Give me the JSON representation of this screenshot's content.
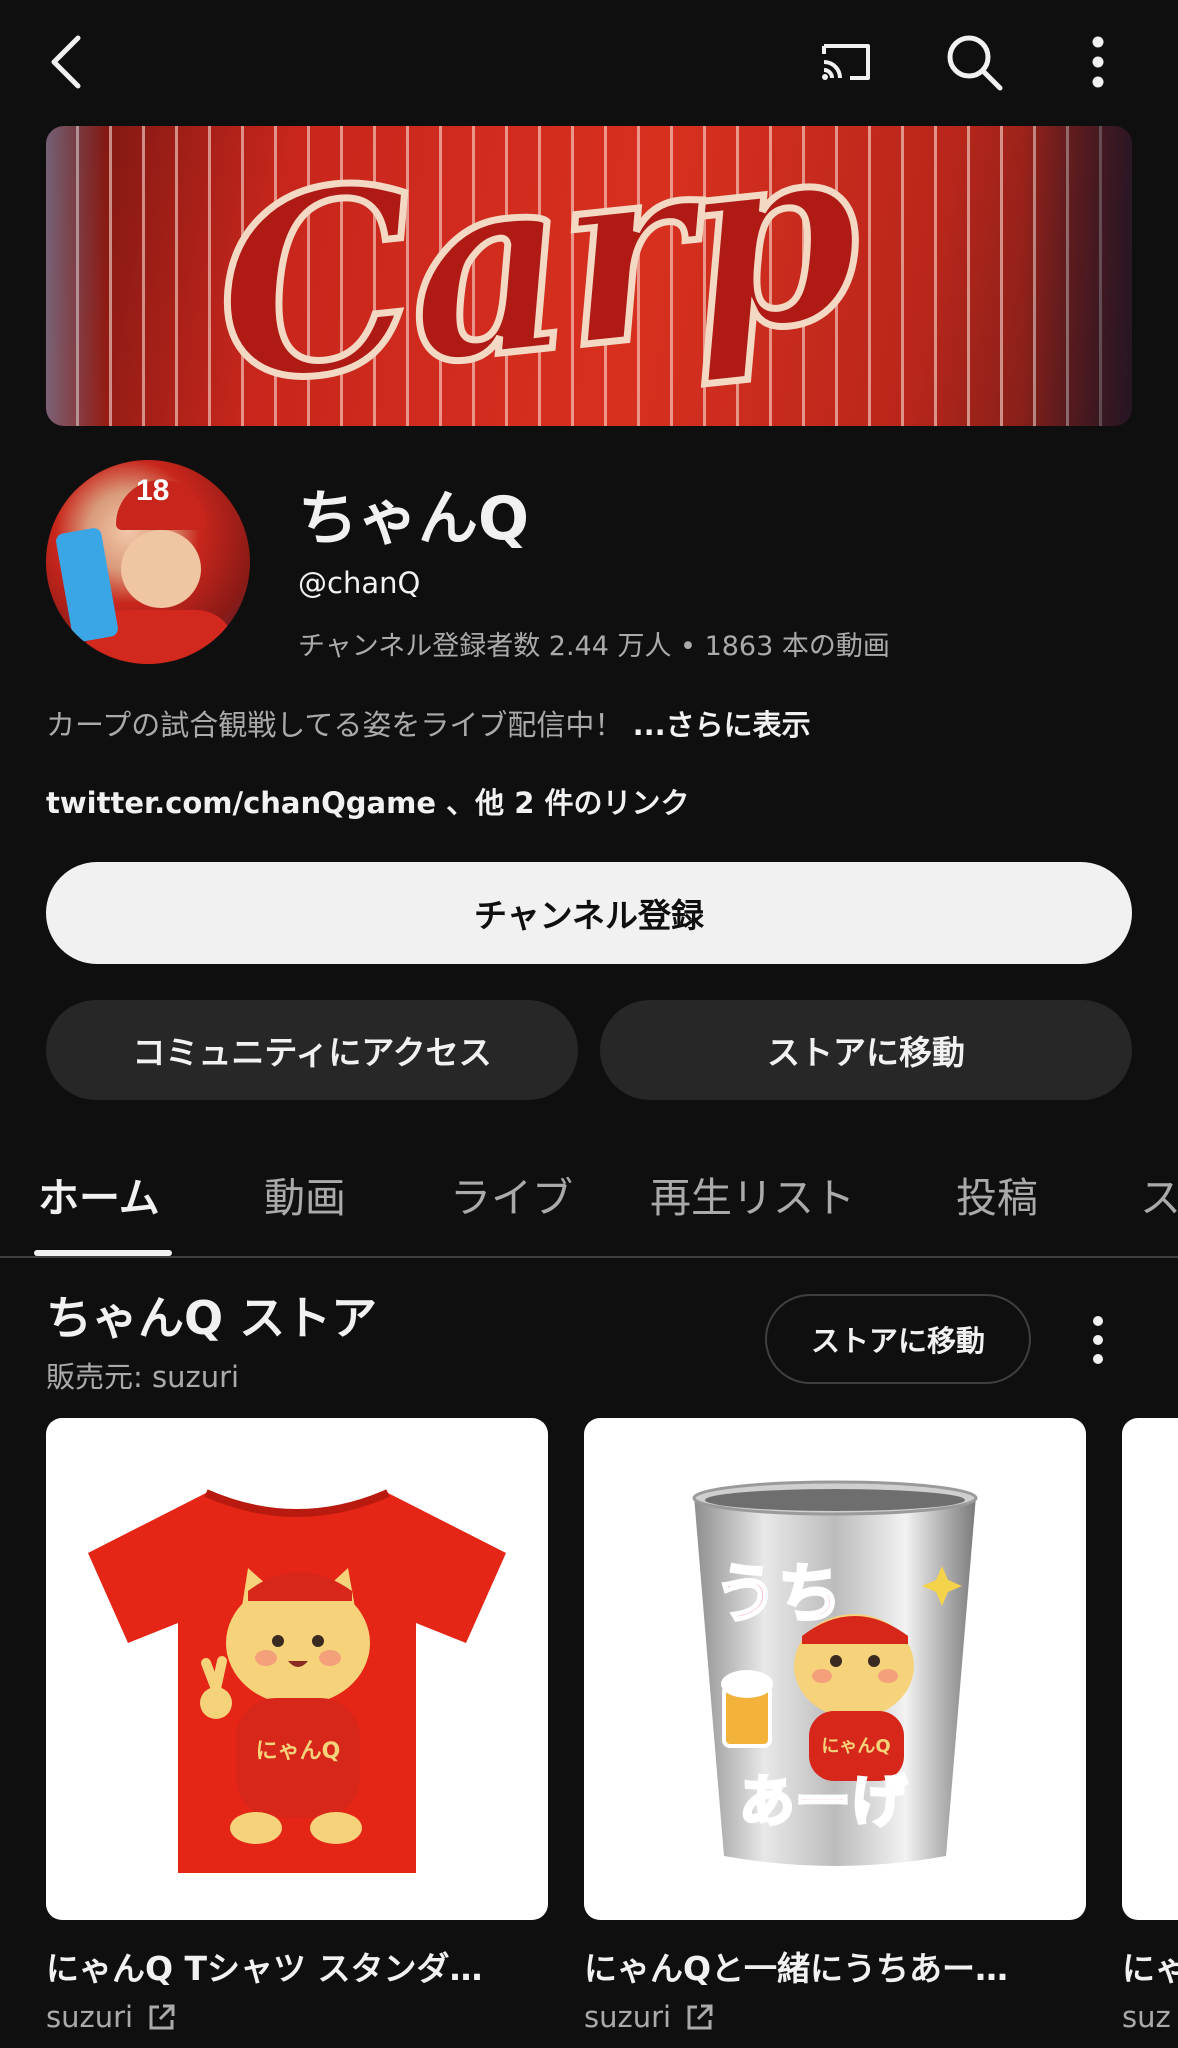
{
  "header": {
    "back_icon": "chevron-left-icon",
    "cast_icon": "cast-icon",
    "search_icon": "search-icon",
    "more_icon": "more-vertical-icon"
  },
  "banner": {
    "logo_text": "Carp",
    "colors": {
      "jersey_red": "#c8261c",
      "stripe": "#f3d8c4"
    }
  },
  "channel": {
    "name": "ちゃんQ",
    "handle": "@chanQ",
    "stats": "チャンネル登録者数 2.44 万人 • 1863 本の動画",
    "description": "カープの試合観戦してる姿をライブ配信中！",
    "description_more": "...さらに表示",
    "links": "twitter.com/chanQgame 、他 2 件のリンク",
    "avatar_jersey_number": "18"
  },
  "actions": {
    "subscribe": "チャンネル登録",
    "community": "コミュニティにアクセス",
    "store": "ストアに移動"
  },
  "tabs": [
    {
      "label": "ホーム",
      "active": true
    },
    {
      "label": "動画"
    },
    {
      "label": "ライブ"
    },
    {
      "label": "再生リスト"
    },
    {
      "label": "投稿"
    },
    {
      "label": "ス"
    }
  ],
  "store": {
    "title": "ちゃんQ ストア",
    "seller": "販売元: suzuri",
    "goto_label": "ストアに移動",
    "products": [
      {
        "title": "にゃんQ Tシャツ スタンダ…",
        "seller": "suzuri",
        "image_text": "にゃんQ"
      },
      {
        "title": "にゃんQと一緒にうちあー…",
        "seller": "suzuri",
        "image_text_top": "うち",
        "image_text_bottom": "あーげ",
        "image_label": "にゃんQ"
      },
      {
        "title": "にゃ",
        "seller": "suz"
      }
    ]
  }
}
